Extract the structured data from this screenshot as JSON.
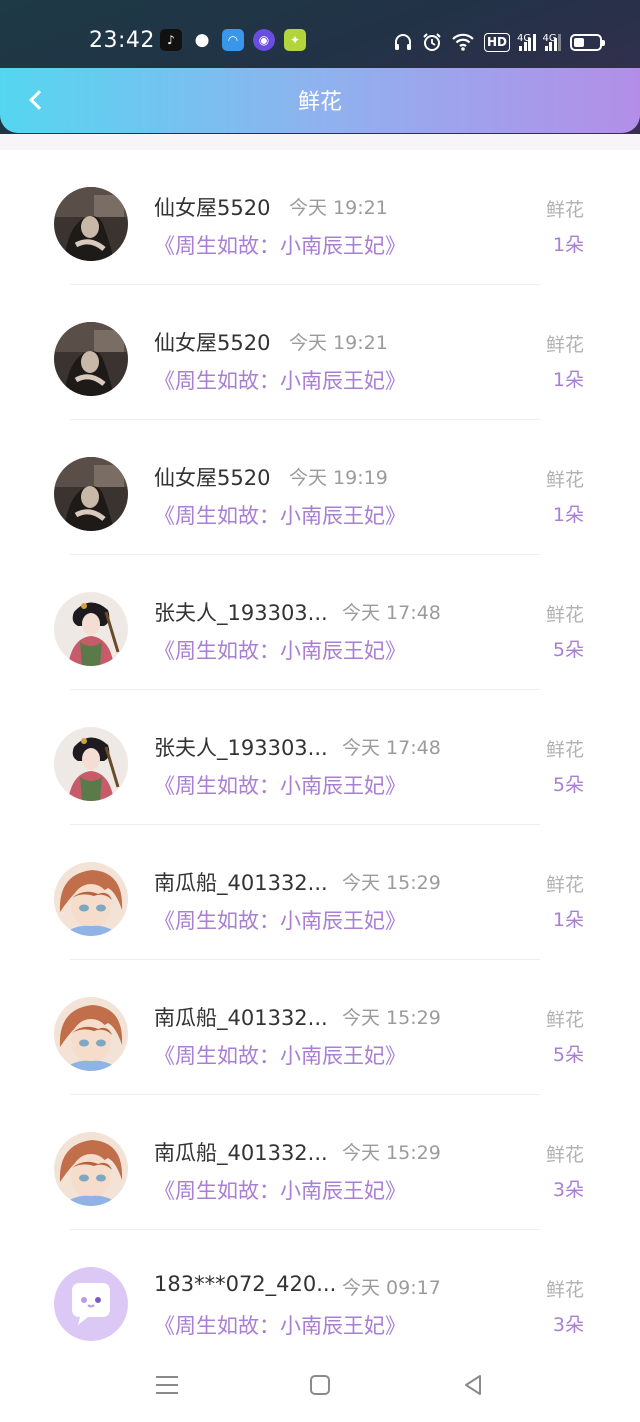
{
  "status_bar": {
    "time": "23:42",
    "app_icons": [
      "tiktok-icon",
      "wechat-icon",
      "browser-icon",
      "music-icon",
      "game-icon"
    ],
    "system_icons": [
      "headphones-icon",
      "alarm-icon",
      "wifi-icon",
      "hd-icon",
      "signal-4g-icon",
      "signal-4g-icon",
      "battery-icon"
    ],
    "hd_label": "HD",
    "network_label": "4G",
    "battery_level": 0.4
  },
  "header": {
    "title": "鲜花",
    "back_icon": "chevron-left-icon"
  },
  "colors": {
    "header_gradient": [
      "#55d6f0",
      "#b38ee8"
    ],
    "accent": "#a87fd3",
    "name_text": "#333333",
    "muted_text": "#9b9b9b"
  },
  "gift_label": "鲜花",
  "items": [
    {
      "name": "仙女屋5520",
      "time": "今天 19:21",
      "book": "《周生如故：小南辰王妃》",
      "label": "鲜花",
      "count": "1朵",
      "avatar": "portrait-dark"
    },
    {
      "name": "仙女屋5520",
      "time": "今天 19:21",
      "book": "《周生如故：小南辰王妃》",
      "label": "鲜花",
      "count": "1朵",
      "avatar": "portrait-dark"
    },
    {
      "name": "仙女屋5520",
      "time": "今天 19:19",
      "book": "《周生如故：小南辰王妃》",
      "label": "鲜花",
      "count": "1朵",
      "avatar": "portrait-dark"
    },
    {
      "name": "张夫人_193303...",
      "time": "今天 17:48",
      "book": "《周生如故：小南辰王妃》",
      "label": "鲜花",
      "count": "5朵",
      "avatar": "portrait-lady"
    },
    {
      "name": "张夫人_193303...",
      "time": "今天 17:48",
      "book": "《周生如故：小南辰王妃》",
      "label": "鲜花",
      "count": "5朵",
      "avatar": "portrait-lady"
    },
    {
      "name": "南瓜船_401332...",
      "time": "今天 15:29",
      "book": "《周生如故：小南辰王妃》",
      "label": "鲜花",
      "count": "1朵",
      "avatar": "portrait-anime"
    },
    {
      "name": "南瓜船_401332...",
      "time": "今天 15:29",
      "book": "《周生如故：小南辰王妃》",
      "label": "鲜花",
      "count": "5朵",
      "avatar": "portrait-anime"
    },
    {
      "name": "南瓜船_401332...",
      "time": "今天 15:29",
      "book": "《周生如故：小南辰王妃》",
      "label": "鲜花",
      "count": "3朵",
      "avatar": "portrait-anime"
    },
    {
      "name": "183***072_420...",
      "time": "今天 09:17",
      "book": "《周生如故：小南辰王妃》",
      "label": "鲜花",
      "count": "3朵",
      "avatar": "default-chat"
    }
  ],
  "nav_bar": {
    "icons": [
      "menu-icon",
      "home-icon",
      "back-triangle-icon"
    ]
  }
}
